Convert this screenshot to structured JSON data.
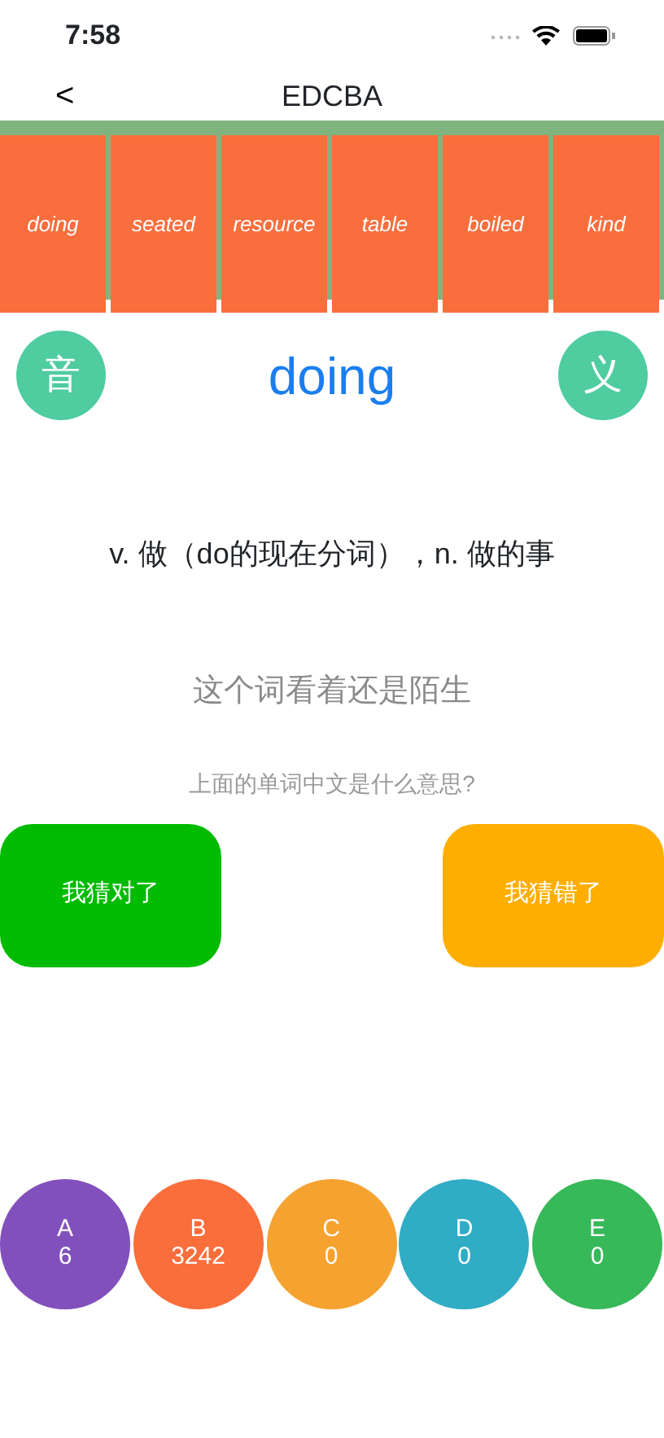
{
  "status_bar": {
    "time": "7:58"
  },
  "nav": {
    "back": "<",
    "title": "EDCBA"
  },
  "word_cards": [
    "doing",
    "seated",
    "resource",
    "table",
    "boiled",
    "kind"
  ],
  "sound_button": "音",
  "meaning_button": "义",
  "word": "doing",
  "definition": "v. 做（do的现在分词），n. 做的事",
  "hint": "这个词看着还是陌生",
  "question": "上面的单词中文是什么意思?",
  "answer_buttons": [
    {
      "label": "我猜对了",
      "color": "#00bb00"
    },
    {
      "label": "我猜错了",
      "color": "#ffae00"
    }
  ],
  "buckets": [
    {
      "letter": "A",
      "count": "6",
      "color": "#8250bc"
    },
    {
      "letter": "B",
      "count": "3242",
      "color": "#fa6e3c"
    },
    {
      "letter": "C",
      "count": "0",
      "color": "#f6a230"
    },
    {
      "letter": "D",
      "count": "0",
      "color": "#31acc5"
    },
    {
      "letter": "E",
      "count": "0",
      "color": "#37b95a"
    }
  ]
}
